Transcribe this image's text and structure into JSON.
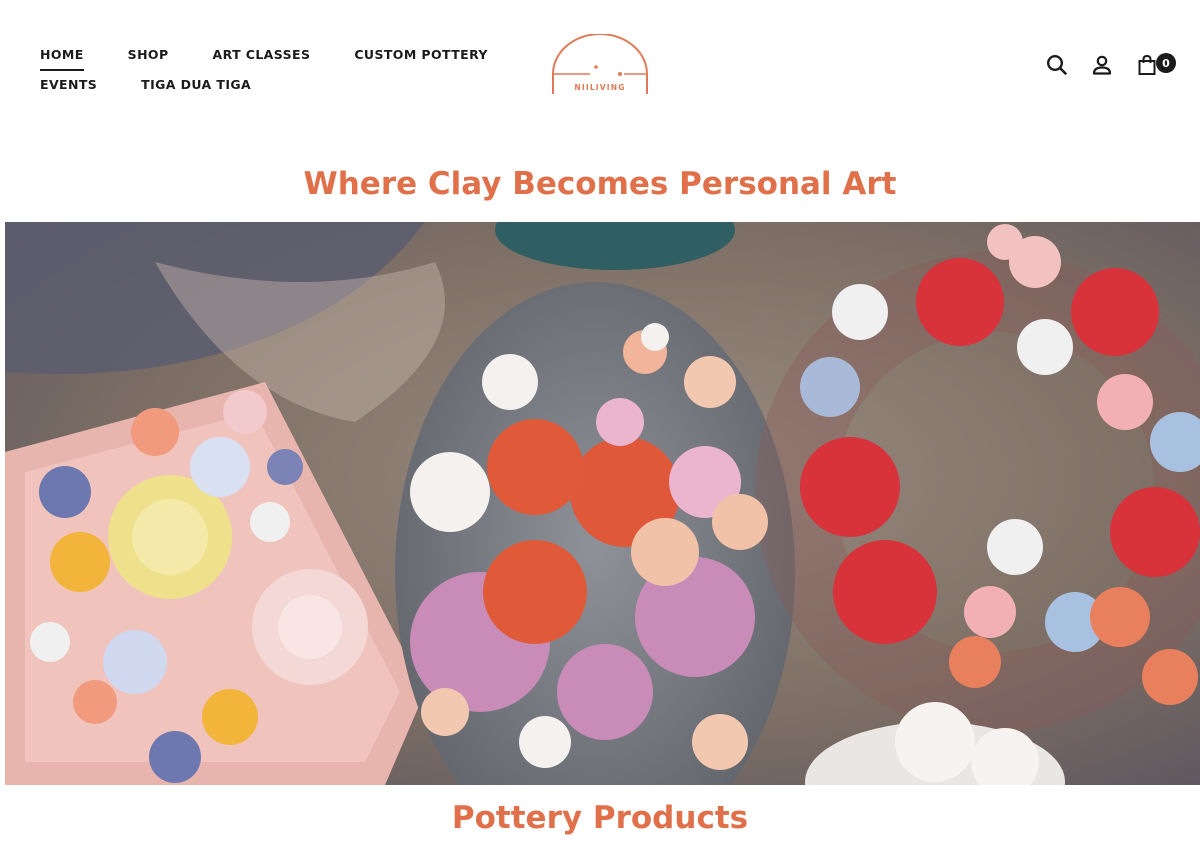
{
  "nav": {
    "row1": [
      "HOME",
      "SHOP",
      "ART CLASSES",
      "CUSTOM POTTERY"
    ],
    "row2": [
      "EVENTS",
      "TIGA DUA TIGA"
    ],
    "active": "HOME"
  },
  "logo": {
    "text": "NIILIVING"
  },
  "header_icons": [
    "search-icon",
    "account-icon",
    "cart-icon"
  ],
  "cart": {
    "count": "0"
  },
  "hero": {
    "title": "Where Clay Becomes Personal Art"
  },
  "sections": {
    "products_title": "Pottery Products"
  },
  "colors": {
    "accent": "#e0704a",
    "text": "#1b1b1b",
    "background": "#ffffff"
  }
}
